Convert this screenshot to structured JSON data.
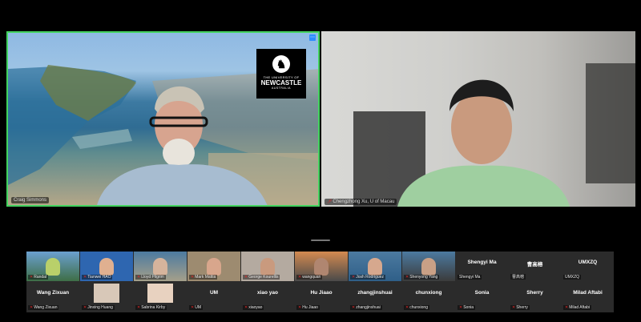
{
  "videos": [
    {
      "name": "Craig Simmons",
      "logo": {
        "line1": "THE UNIVERSITY OF",
        "line2": "NEWCASTLE",
        "line3": "AUSTRALIA"
      }
    },
    {
      "name": "Chengzhong Xu, U of Macau"
    }
  ],
  "gallery": [
    {
      "name": "Randal"
    },
    {
      "name": "Tianwei HAO"
    },
    {
      "name": "Lloyd Pilgrim"
    },
    {
      "name": "Mark Mattia"
    },
    {
      "name": "George Kourellis"
    },
    {
      "name": "wangquan"
    },
    {
      "name": "Josh Rodriguez"
    },
    {
      "name": "Shenyong Yang"
    },
    {
      "name": "Shengyi Ma",
      "display": "Shengyi Ma"
    },
    {
      "name": "曹高榕",
      "display": "曹高榕"
    },
    {
      "name": "UMXZQ",
      "display": "UMXZQ"
    },
    {
      "name": "Wang Zixuan",
      "display": "Wang Zixuan"
    },
    {
      "name": "Jinxing Huang"
    },
    {
      "name": "Sabrina Kirby"
    },
    {
      "name": "UM",
      "display": "UM"
    },
    {
      "name": "xiaoyao",
      "display": "xiao yao"
    },
    {
      "name": "Hu Jiaao",
      "display": "Hu Jiaao"
    },
    {
      "name": "zhangjinshuai",
      "display": "zhangjinshuai"
    },
    {
      "name": "chunxiong",
      "display": "chunxiong"
    },
    {
      "name": "Sonia",
      "display": "Sonia"
    },
    {
      "name": "Sherry",
      "display": "Sherry"
    },
    {
      "name": "Milad Aftabi",
      "display": "Milad Aftabi"
    }
  ],
  "colors": {
    "active_speaker": "#43d35f",
    "muted": "#e02828"
  }
}
